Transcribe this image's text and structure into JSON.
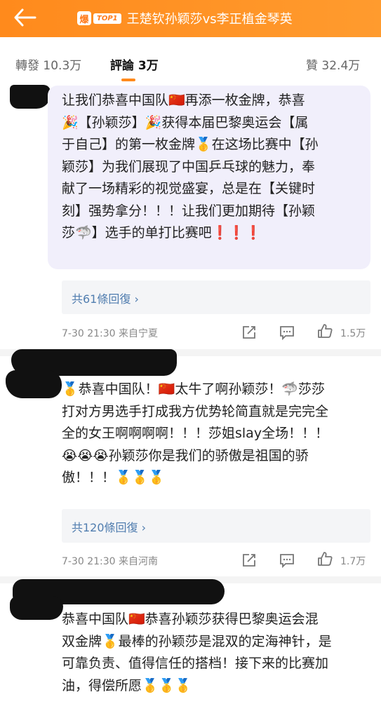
{
  "header": {
    "hot_badge": "爆",
    "rank_badge": "TOP1",
    "title": "王楚钦孙颖莎vs李正植金琴英"
  },
  "tabs": {
    "repost_label": "轉發",
    "repost_count": "10.3万",
    "comment_label": "評論",
    "comment_count": "3万",
    "like_label": "贊",
    "like_count": "32.4万"
  },
  "comments": [
    {
      "lines": [
        "让我们恭喜中国队🇨🇳再添一枚金牌，恭喜",
        "🎉【孙颖莎】🎉获得本届巴黎奥运会【属",
        "于自己】的第一枚金牌🥇在这场比赛中【孙",
        "颖莎】为我们展现了中国乒乓球的魅力，奉",
        "献了一场精彩的视觉盛宴，总是在【关键时",
        "刻】强势拿分！！！让我们更加期待【孙颖",
        "莎🦈】选手的单打比赛吧❗❗❗"
      ],
      "replies": "共61條回復",
      "time": "7-30 21:30",
      "location": "来自宁夏",
      "likes": "1.5万"
    },
    {
      "lines": [
        "🥇恭喜中国队！🇨🇳太牛了啊孙颖莎！🦈莎莎",
        "打对方男选手打成我方优势轮简直就是完完全",
        "全的女王啊啊啊啊！！！莎姐slay全场！！！",
        "😭😭😭孙颖莎你是我们的骄傲是祖国的骄",
        "傲！！！🥇🥇🥇"
      ],
      "replies": "共120條回復",
      "time": "7-30 21:30",
      "location": "来自河南",
      "likes": "1.7万"
    },
    {
      "lines": [
        "恭喜中国队🇨🇳恭喜孙颖莎获得巴黎奥运会混",
        "双金牌🥇最棒的孙颖莎是混双的定海神针，是",
        "可靠负责、值得信任的搭档！接下来的比赛加",
        "油，得偿所愿🥇🥇🥇"
      ]
    }
  ],
  "icons": {
    "back": "back-arrow-icon",
    "repost": "repost-icon",
    "comment": "comment-icon",
    "like": "thumbs-up-icon"
  },
  "colors": {
    "header": "#ff8a1c",
    "link": "#507daf",
    "bubble": "#f1effb"
  }
}
